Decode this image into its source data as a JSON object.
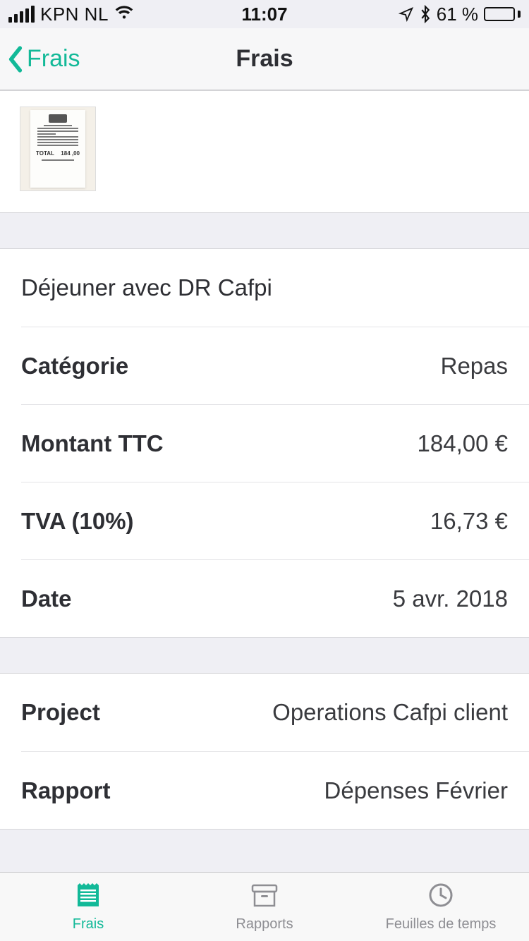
{
  "status": {
    "carrier": "KPN NL",
    "time": "11:07",
    "battery_pct": "61 %"
  },
  "nav": {
    "back_label": "Frais",
    "title": "Frais"
  },
  "receipt_thumb": {
    "total_label": "TOTAL",
    "total_value": "184 ,00"
  },
  "expense": {
    "title": "Déjeuner avec DR Cafpi",
    "category_label": "Catégorie",
    "category_value": "Repas",
    "amount_label": "Montant TTC",
    "amount_value": "184,00 €",
    "vat_label": "TVA (10%)",
    "vat_value": "16,73 €",
    "date_label": "Date",
    "date_value": "5 avr. 2018"
  },
  "assoc": {
    "project_label": "Project",
    "project_value": "Operations Cafpi client",
    "report_label": "Rapport",
    "report_value": "Dépenses Février"
  },
  "tabs": {
    "expenses": "Frais",
    "reports": "Rapports",
    "timesheets": "Feuilles de temps"
  }
}
